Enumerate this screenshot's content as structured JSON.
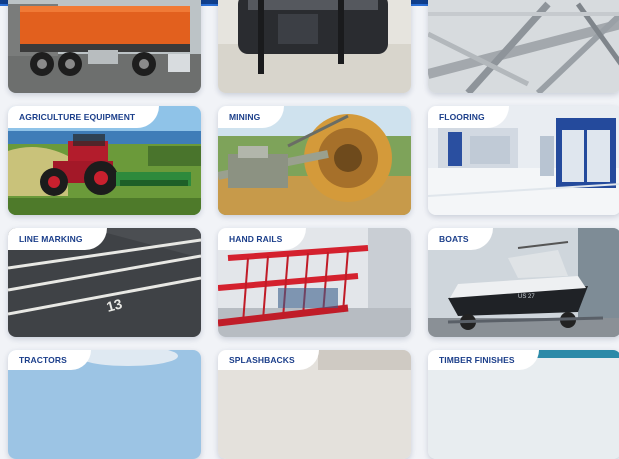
{
  "cards": [
    {
      "id": "truck",
      "label": "",
      "row": 0,
      "col": 1,
      "icon": "tipper-truck-photo"
    },
    {
      "id": "bins",
      "label": "",
      "row": 0,
      "col": 2,
      "icon": "steel-bins-photo"
    },
    {
      "id": "structure",
      "label": "",
      "row": 0,
      "col": 3,
      "icon": "steel-structure-photo"
    },
    {
      "id": "agriculture",
      "label": "AGRICULTURE EQUIPMENT",
      "row": 1,
      "col": 1,
      "icon": "tractor-photo"
    },
    {
      "id": "mining",
      "label": "MINING",
      "row": 1,
      "col": 2,
      "icon": "bucket-wheel-excavator-photo"
    },
    {
      "id": "flooring",
      "label": "FLOORING",
      "row": 1,
      "col": 3,
      "icon": "spray-booth-floor-photo"
    },
    {
      "id": "line-marking",
      "label": "LINE MARKING",
      "row": 2,
      "col": 1,
      "icon": "car-park-lines-photo"
    },
    {
      "id": "hand-rails",
      "label": "HAND RAILS",
      "row": 2,
      "col": 2,
      "icon": "red-trolley-rails-photo"
    },
    {
      "id": "boats",
      "label": "BOATS",
      "row": 2,
      "col": 3,
      "icon": "boat-on-trailer-photo"
    },
    {
      "id": "tractors",
      "label": "TRACTORS",
      "row": 3,
      "col": 1,
      "icon": "tractor-sky-photo"
    },
    {
      "id": "splashbacks",
      "label": "SPLASHBACKS",
      "row": 3,
      "col": 2,
      "icon": "kitchen-photo"
    },
    {
      "id": "timber-finishes",
      "label": "TIMBER FINISHES",
      "row": 3,
      "col": 3,
      "icon": "timber-photo"
    }
  ],
  "colors": {
    "brand_blue": "#1b3e8a",
    "topbar": "#0f3e8c",
    "page_bg": "#f1f3f7"
  }
}
